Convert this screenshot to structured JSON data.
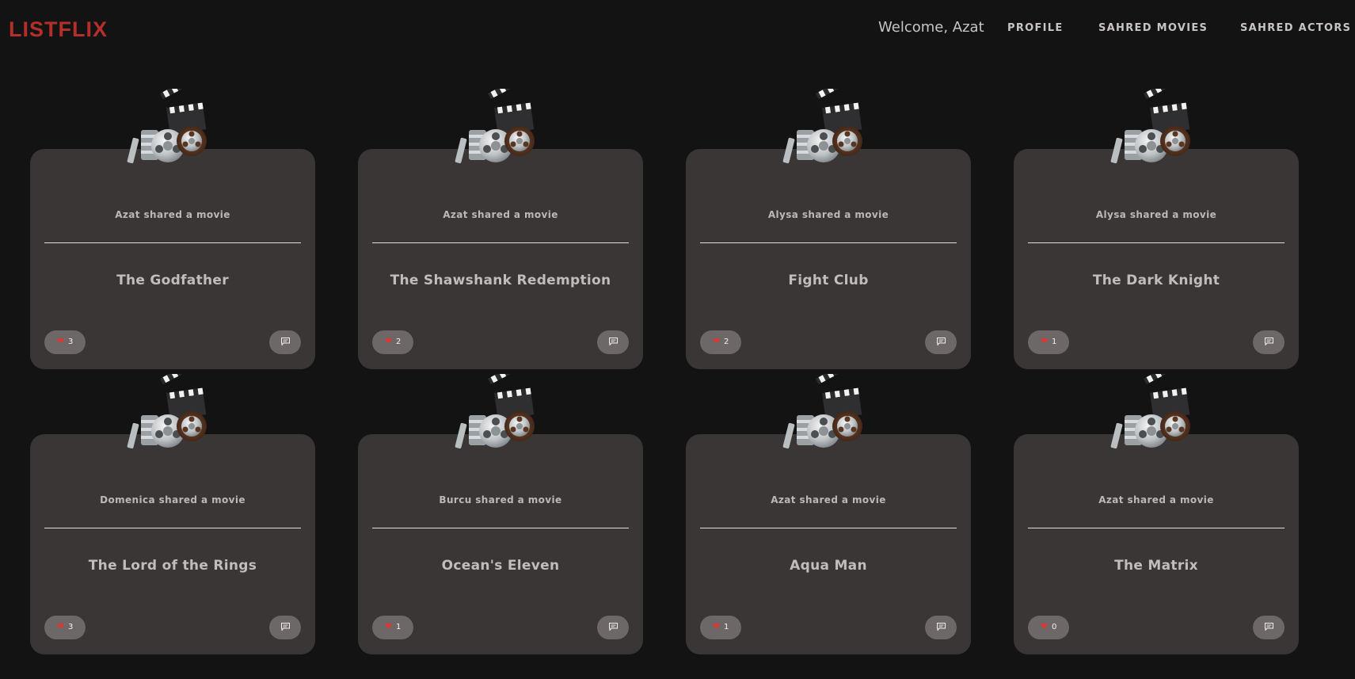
{
  "app": {
    "logo": "LISTFLIX",
    "welcome": "Welcome, Azat"
  },
  "nav": {
    "profile": "PROFILE",
    "shared_movies": "SAHRED MOVIES",
    "shared_actors": "SAHRED ACTORS"
  },
  "colors": {
    "background": "#141314",
    "card": "#3a3635",
    "brand": "#b42f2a",
    "heart": "#e5342d"
  },
  "icons": {
    "movie": "film-reel-clapperboard-icon",
    "like": "heart-icon",
    "comment": "comment-icon"
  },
  "cards": [
    {
      "sharer": "Azat shared a movie",
      "title": "The Godfather",
      "likes": "3"
    },
    {
      "sharer": "Azat shared a movie",
      "title": "The Shawshank Redemption",
      "likes": "2"
    },
    {
      "sharer": "Alysa shared a movie",
      "title": "Fight Club",
      "likes": "2"
    },
    {
      "sharer": "Alysa shared a movie",
      "title": "The Dark Knight",
      "likes": "1"
    },
    {
      "sharer": "Domenica shared a movie",
      "title": "The Lord of the Rings",
      "likes": "3"
    },
    {
      "sharer": "Burcu shared a movie",
      "title": "Ocean's Eleven",
      "likes": "1"
    },
    {
      "sharer": "Azat shared a movie",
      "title": "Aqua Man",
      "likes": "1"
    },
    {
      "sharer": "Azat shared a movie",
      "title": "The Matrix",
      "likes": "0"
    }
  ]
}
